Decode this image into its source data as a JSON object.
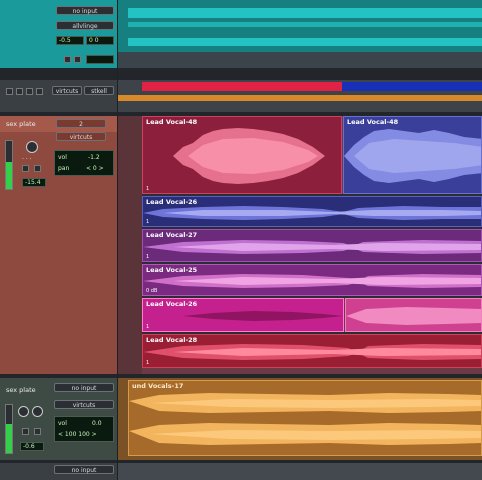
{
  "colors": {
    "teal_track": "#1aa7a8",
    "lead_track": "#a15a4f",
    "sidebar_bg": "#8e4a3e",
    "orange_track": "#b3782e",
    "clip_dark_red": "#8b1f3c",
    "clip_blue": "#3a3f9a",
    "clip_magenta": "#c4208e",
    "playhead_strip_red": "#e02244",
    "playhead_strip_blue": "#1830b8"
  },
  "track1": {
    "input": "no input",
    "voice": "allvlinge",
    "value_left": "-0.5",
    "value_right": "0 0"
  },
  "track2": {
    "voice": "virtcuts",
    "mode": "stkell"
  },
  "lead": {
    "name": "sex plate",
    "number": "2",
    "voice": "virtcuts",
    "vol_label": "vol",
    "vol_value": "-1.2",
    "pan_label": "pan",
    "pan_value": "< 0 >",
    "fader_value": "-15.4"
  },
  "clips": [
    {
      "name": "Lead Vocal-48",
      "num": "1"
    },
    {
      "name": "Lead Vocal-48",
      "num": ""
    },
    {
      "name": "Lead Vocal-26",
      "num": "1"
    },
    {
      "name": "Lead Vocal-27",
      "num": "1"
    },
    {
      "name": "Lead Vocal-25",
      "num": "",
      "extra": "0 dB"
    },
    {
      "name": "Lead Vocal-26",
      "num": "1"
    },
    {
      "name": "Lead Vocal-28",
      "num": "1"
    }
  ],
  "track4": {
    "name": "sex plate",
    "input": "no input",
    "voice": "virtcuts",
    "vol_label": "vol",
    "vol_value": "0.0",
    "pan_value": "< 100  100 >",
    "fader_value": "-0.6",
    "clip_name": "und Vocals-17"
  },
  "track5": {
    "input": "no input"
  }
}
